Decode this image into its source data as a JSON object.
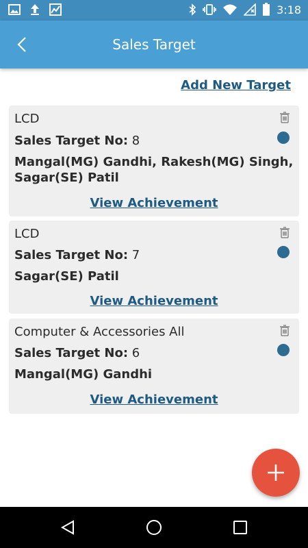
{
  "status_bar": {
    "time": "3:18",
    "left_icons": [
      "image-icon",
      "upload-icon",
      "chart-icon"
    ],
    "right_icons": [
      "bluetooth-icon",
      "vibrate-icon",
      "wifi-icon",
      "no-signal-icon",
      "battery-icon"
    ]
  },
  "app_bar": {
    "title": "Sales Target",
    "back_icon": "chevron-left-icon",
    "color": "#4a9fd4"
  },
  "add_target_label": "Add New Target",
  "cards": [
    {
      "category": "LCD",
      "target_label": "Sales Target No:",
      "target_no": "8",
      "names": "Mangal(MG) Gandhi, Rakesh(MG) Singh, Sagar(SE) Patil",
      "view_label": "View Achievement"
    },
    {
      "category": "LCD",
      "target_label": "Sales Target No:",
      "target_no": "7",
      "names": "Sagar(SE) Patil",
      "view_label": "View Achievement"
    },
    {
      "category": "Computer & Accessories All",
      "target_label": "Sales Target No:",
      "target_no": "6",
      "names": "Mangal(MG) Gandhi",
      "view_label": "View Achievement"
    }
  ],
  "fab": {
    "icon": "plus-icon",
    "color": "#e5533e"
  },
  "nav_bar": {
    "icons": [
      "back-triangle-icon",
      "home-circle-icon",
      "recents-square-icon"
    ]
  }
}
